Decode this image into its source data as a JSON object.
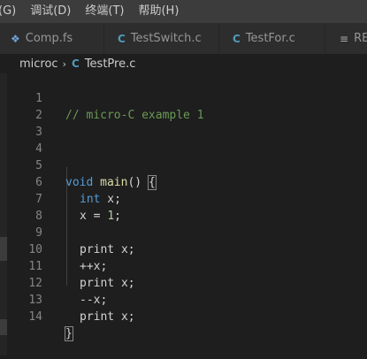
{
  "menu": {
    "items": [
      "(G)",
      "调试(D)",
      "终端(T)",
      "帮助(H)"
    ]
  },
  "tabs": [
    {
      "label": "Comp.fs",
      "icon": "fsharp-file-icon",
      "glyph": "❖"
    },
    {
      "label": "TestSwitch.c",
      "icon": "c-file-icon",
      "glyph": "C"
    },
    {
      "label": "TestFor.c",
      "icon": "c-file-icon",
      "glyph": "C"
    },
    {
      "label": "REA",
      "icon": "readme-file-icon",
      "glyph": "≡"
    }
  ],
  "breadcrumb": {
    "folder": "microc",
    "separator": "›",
    "file_icon": "C",
    "file": "TestPre.c"
  },
  "editor": {
    "line_numbers": [
      "1",
      "2",
      "3",
      "4",
      "5",
      "6",
      "7",
      "8",
      "9",
      "10",
      "11",
      "12",
      "13",
      "14"
    ],
    "code": {
      "l1_comment": "// micro-C example 1",
      "l5_kw": "void",
      "l5_fn": "main",
      "l5_paren": "() ",
      "l5_brace": "{",
      "l6_kw": "int",
      "l6_rest": " x;",
      "l7_pre": "x = ",
      "l7_num": "1",
      "l7_post": ";",
      "l9": "print x;",
      "l10": "++x;",
      "l11": "print x;",
      "l12": "--x;",
      "l13": "print x;",
      "l14_brace": "}"
    }
  },
  "colors": {
    "background": "#1e1e1e",
    "comment": "#6a9955",
    "keyword": "#569cd6",
    "function": "#dcdcaa",
    "number": "#b5cea8",
    "c_icon": "#519aba"
  }
}
